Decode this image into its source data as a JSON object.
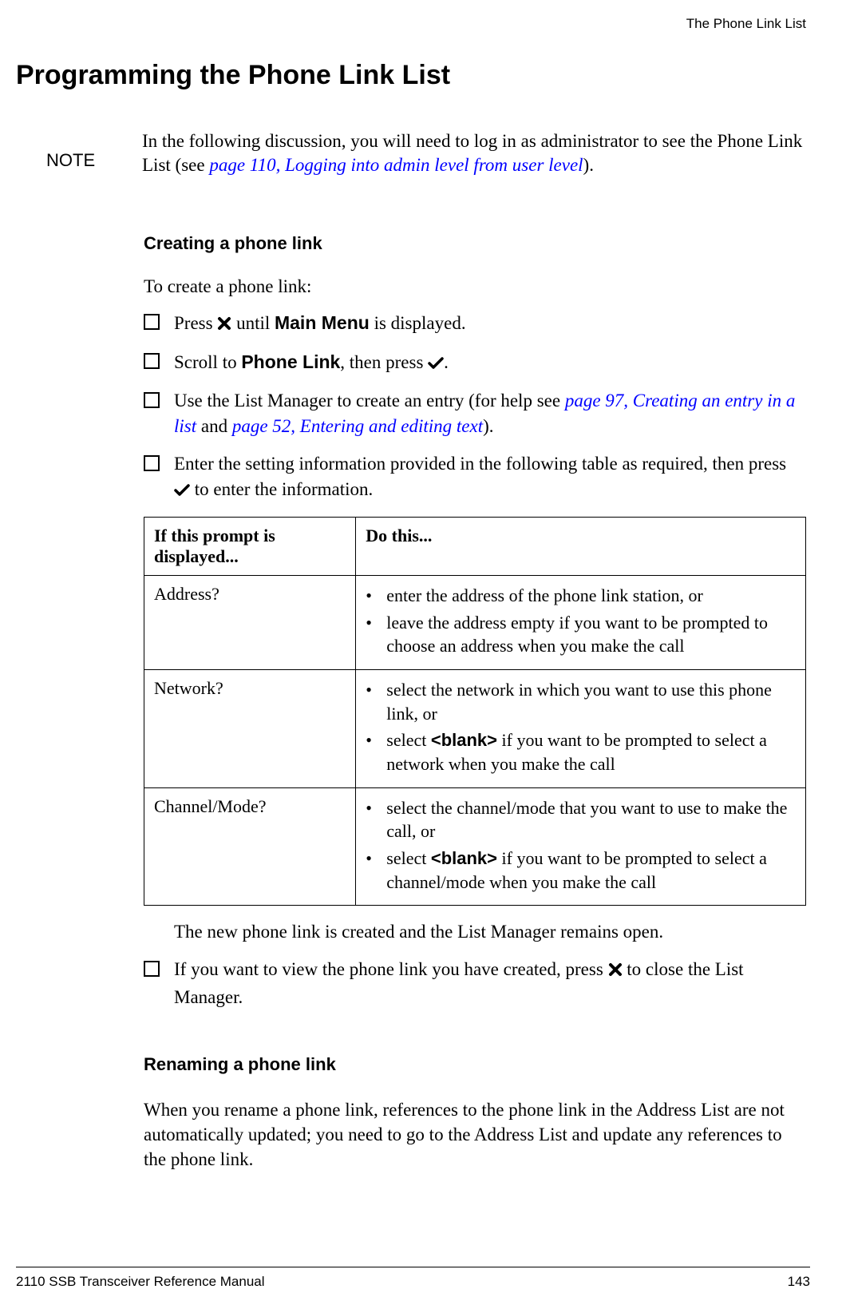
{
  "header": {
    "running_title": "The Phone Link List"
  },
  "title": "Programming the Phone Link List",
  "note": {
    "label": "NOTE",
    "text_before": "In the following discussion, you will need to log in as administrator to see the Phone Link List (see ",
    "xref_text": "page 110, Logging into admin level from user level",
    "text_after": ")."
  },
  "section1": {
    "heading": "Creating a phone link",
    "lead": "To create a phone link:",
    "items": {
      "i0": {
        "pre": "Press ",
        "post_a": " until ",
        "bold": "Main Menu",
        "post_b": " is displayed."
      },
      "i1": {
        "pre": "Scroll to ",
        "bold": "Phone Link",
        "mid": ", then press ",
        "post": "."
      },
      "i2": {
        "pre": "Use the List Manager to create an entry (for help see ",
        "xref1": "page 97, Creating an entry in a list",
        "mid": " and ",
        "xref2": "page 52, Entering and editing text",
        "post": ")."
      },
      "i3": {
        "pre": "Enter the setting information provided in the following table as required, then press ",
        "post": " to enter the information."
      }
    }
  },
  "table": {
    "head": {
      "c0": "If this prompt is displayed...",
      "c1": "Do this..."
    },
    "rows": {
      "r0": {
        "prompt": "Address?",
        "b0": "enter the address of the phone link station, or",
        "b1": "leave the address empty if you want to be prompted to choose an address when you make the call"
      },
      "r1": {
        "prompt": "Network?",
        "b0": "select the network in which you want to use this phone link, or",
        "b1_pre": "select ",
        "b1_bold": "<blank>",
        "b1_post": " if you want to be prompted to select a network when you make the call"
      },
      "r2": {
        "prompt": "Channel/Mode?",
        "b0": "select the channel/mode that you want to use to make the call, or",
        "b1_pre": "select ",
        "b1_bold": "<blank>",
        "b1_post": " if you want to be prompted to select a channel/mode when you make the call"
      }
    }
  },
  "after_table": "The new phone link is created and the List Manager remains open.",
  "item5": {
    "pre": "If you want to view the phone link you have created, press ",
    "post": " to close the List Manager."
  },
  "section2": {
    "heading": "Renaming a phone link",
    "body": "When you rename a phone link, references to the phone link in the Address List are not automatically updated; you need to go to the Address List and update any references to the phone link."
  },
  "footer": {
    "left": "2110 SSB Transceiver Reference Manual",
    "right": "143"
  }
}
